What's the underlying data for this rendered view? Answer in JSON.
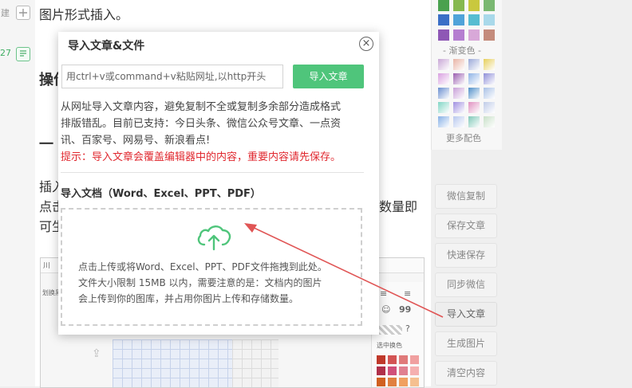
{
  "left_strip": {
    "items": [
      {
        "label": "建",
        "icon": "plus-square-icon"
      },
      {
        "label": "27",
        "icon": "document-icon"
      }
    ]
  },
  "editor": {
    "line1": "图片形式插入。",
    "heading_partial": "操作",
    "dash": "一",
    "insert_partial": "插入",
    "click_partial": "点击",
    "can_partial": "可生",
    "right_partial": "数量即",
    "embedded_screenshot": {
      "top_left_label": "川",
      "toolbar_label": "划换黑",
      "quote_label": "99",
      "select_color_label": "选中换色"
    }
  },
  "color_panel": {
    "gradient_label": "- 渐变色 -",
    "more_label": "更多配色",
    "colors": {
      "row1": [
        "#4aa14e",
        "#86b84f",
        "#c9c83e",
        "#7ab872"
      ],
      "row2": [
        "#3b6fc6",
        "#4fa3d9",
        "#56bdd1",
        "#a9d9ea"
      ],
      "row3": [
        "#8e57b5",
        "#b57ed0",
        "#d8a8d8",
        "#c48c7c"
      ],
      "grad1": [
        "#c9a7d6",
        "#e8b3a5",
        "#9aa8d8",
        "#e6cf5a"
      ],
      "grad2": [
        "#d9a0e0",
        "#9a5fb0",
        "#8fb3e6",
        "#8f8fd8"
      ],
      "grad3": [
        "#6a8fd0",
        "#c8a0d8",
        "#4f8fc8",
        "#a9c1e6"
      ],
      "grad4": [
        "#82d6c6",
        "#a090e0",
        "#e090c0",
        "#c0cce8"
      ],
      "grad5": [
        "#86b0e6",
        "#b8c8ee",
        "#80c8b8",
        "#c8e0c8"
      ]
    }
  },
  "right_buttons": [
    "微信复制",
    "保存文章",
    "快速保存",
    "同步微信",
    "导入文章",
    "生成图片",
    "清空内容"
  ],
  "dialog": {
    "title": "导入文章&文件",
    "url_placeholder": "用ctrl+v或command+v粘贴网址,以http开头",
    "import_button": "导入文章",
    "desc_line1": "从网址导入文章内容，避免复制不全或复制多余部分造成格式",
    "desc_line2": "排版错乱。目前已支持：今日头条、微信公众号文章、一点资",
    "desc_line3": "讯、百家号、网易号、新浪看点!",
    "warning": "提示：导入文章会覆盖编辑器中的内容，重要内容请先保存。",
    "doc_title": "导入文档（Word、Excel、PPT、PDF）",
    "upload_line1": "点击上传或将Word、Excel、PPT、PDF文件拖拽到此处。",
    "upload_line2": "文件大小限制 15MB 以内，需要注意的是：文档内的图片",
    "upload_line3": "会上传到你的图库，并占用你图片上传和存储数量。"
  },
  "accent_colors": {
    "green": "#4fc57b",
    "warning_red": "#e0282f",
    "arrow_red": "#e05555"
  }
}
